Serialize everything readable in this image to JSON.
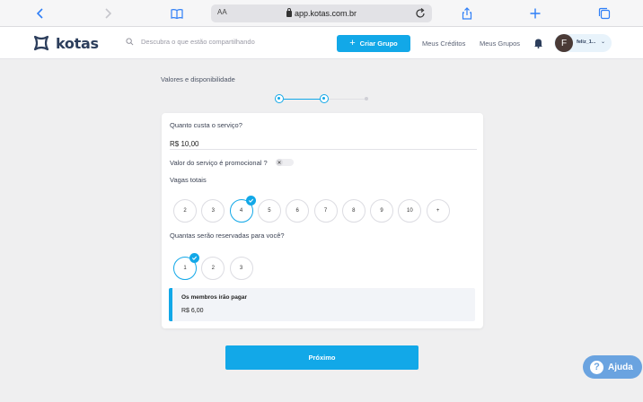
{
  "browser": {
    "url_prefix": "AA",
    "url": "app.kotas.com.br",
    "icons": [
      "chevron-left-icon",
      "chevron-right-icon",
      "book-icon",
      "lock-icon",
      "reload-icon",
      "share-icon",
      "plus-icon",
      "tabs-icon"
    ]
  },
  "header": {
    "logo_text": "kotas",
    "search_placeholder": "Descubra o que estão compartilhando",
    "create_group_label": "Criar Grupo",
    "nav_credits": "Meus Créditos",
    "nav_groups": "Meus Grupos",
    "user_initial": "F",
    "user_name": "feliz_1..."
  },
  "form": {
    "section_label": "Valores e disponibilidade",
    "stepper": {
      "total_steps": 3,
      "current_step": 2
    },
    "price_question": "Quanto custa o serviço?",
    "price_value": "R$ 10,00",
    "promo_question": "Valor do serviço é promocional ?",
    "promo_enabled": false,
    "slots_label": "Vagas totais",
    "slot_options": [
      "2",
      "3",
      "4",
      "5",
      "6",
      "7",
      "8",
      "9",
      "10",
      "+"
    ],
    "slot_selected": "4",
    "reserved_question": "Quantas serão reservadas para você?",
    "reserved_options": [
      "1",
      "2",
      "3"
    ],
    "reserved_selected": "1",
    "summary_title": "Os membros irão pagar",
    "summary_value": "R$ 6,00",
    "next_button": "Próximo"
  },
  "help": {
    "label": "Ajuda"
  },
  "colors": {
    "accent": "#12a8e8",
    "help": "#6aa3e0",
    "background": "#efeff0",
    "brand_text": "#2c3e5c"
  }
}
